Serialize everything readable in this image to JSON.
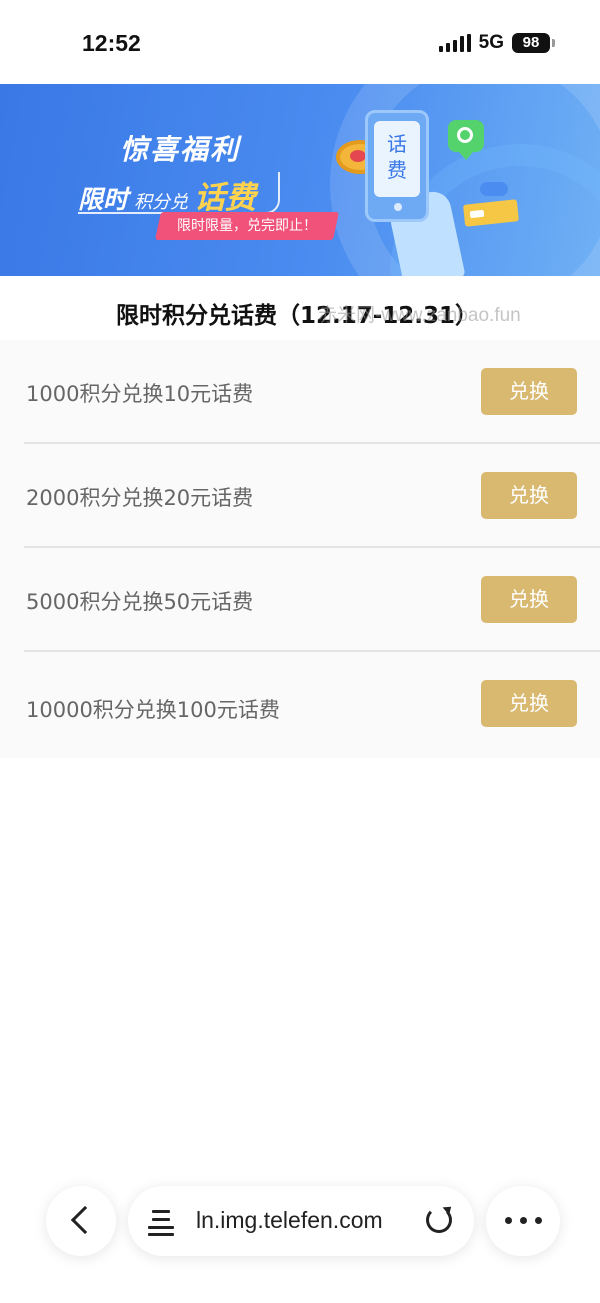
{
  "status_bar": {
    "time": "12:52",
    "network": "5G",
    "battery": "98",
    "icons": [
      "signal-icon",
      "battery-icon"
    ]
  },
  "banner": {
    "headline": "惊喜福利",
    "sub_strong": "限时",
    "sub_mid": "积分兑",
    "sub_accent": "话费",
    "tag": "限时限量，兑完即止！",
    "phone_text_1": "话",
    "phone_text_2": "费",
    "colors": {
      "background": "#3a78e6",
      "accent": "#ffd34d",
      "tag": "#f0527a"
    }
  },
  "page": {
    "title": "限时积分兑话费（12.17-12.31）",
    "watermark": "赤米网-www.zanbao.fun"
  },
  "offers": [
    {
      "label": "1000积分兑换10元话费",
      "button": "兑换"
    },
    {
      "label": "2000积分兑换20元话费",
      "button": "兑换"
    },
    {
      "label": "5000积分兑换50元话费",
      "button": "兑换"
    },
    {
      "label": "10000积分兑换100元话费",
      "button": "兑换"
    }
  ],
  "theme": {
    "button_color": "#d9b96f",
    "list_background": "#fafafa"
  },
  "browser": {
    "url": "ln.img.telefen.com",
    "icons": [
      "back-icon",
      "reader-icon",
      "reload-icon",
      "more-icon"
    ]
  }
}
